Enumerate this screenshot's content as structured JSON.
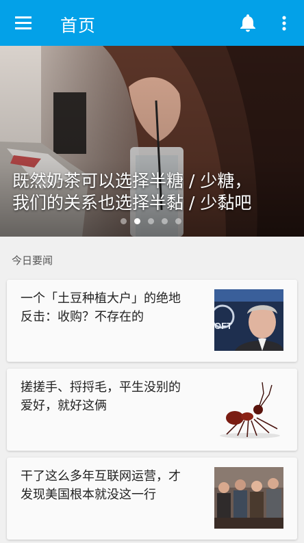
{
  "app_bar": {
    "title": "首页",
    "menu_icon": "hamburger-menu-icon",
    "notification_icon": "bell-icon",
    "overflow_icon": "more-vert-icon",
    "background_color": "#03a1e8"
  },
  "banner": {
    "caption_line1": "既然奶茶可以选择半糖 / 少糖，",
    "caption_line2": "我们的关系也选择半黏 / 少黏吧",
    "dot_count": 5,
    "active_dot": 1
  },
  "section": {
    "title": "今日要闻"
  },
  "stories": [
    {
      "title_line1": "一个「土豆种植大户」的绝地",
      "title_line2": "反击：收购？不存在的",
      "thumbnail": "man-in-suit-photo"
    },
    {
      "title_line1": "搓搓手、捋捋毛，平生没别的",
      "title_line2": "爱好，就好这俩",
      "thumbnail": "ant-photo"
    },
    {
      "title_line1": "干了这么多年互联网运营，才",
      "title_line2": "发现美国根本就没这一行",
      "thumbnail": "conference-audience-photo"
    }
  ]
}
